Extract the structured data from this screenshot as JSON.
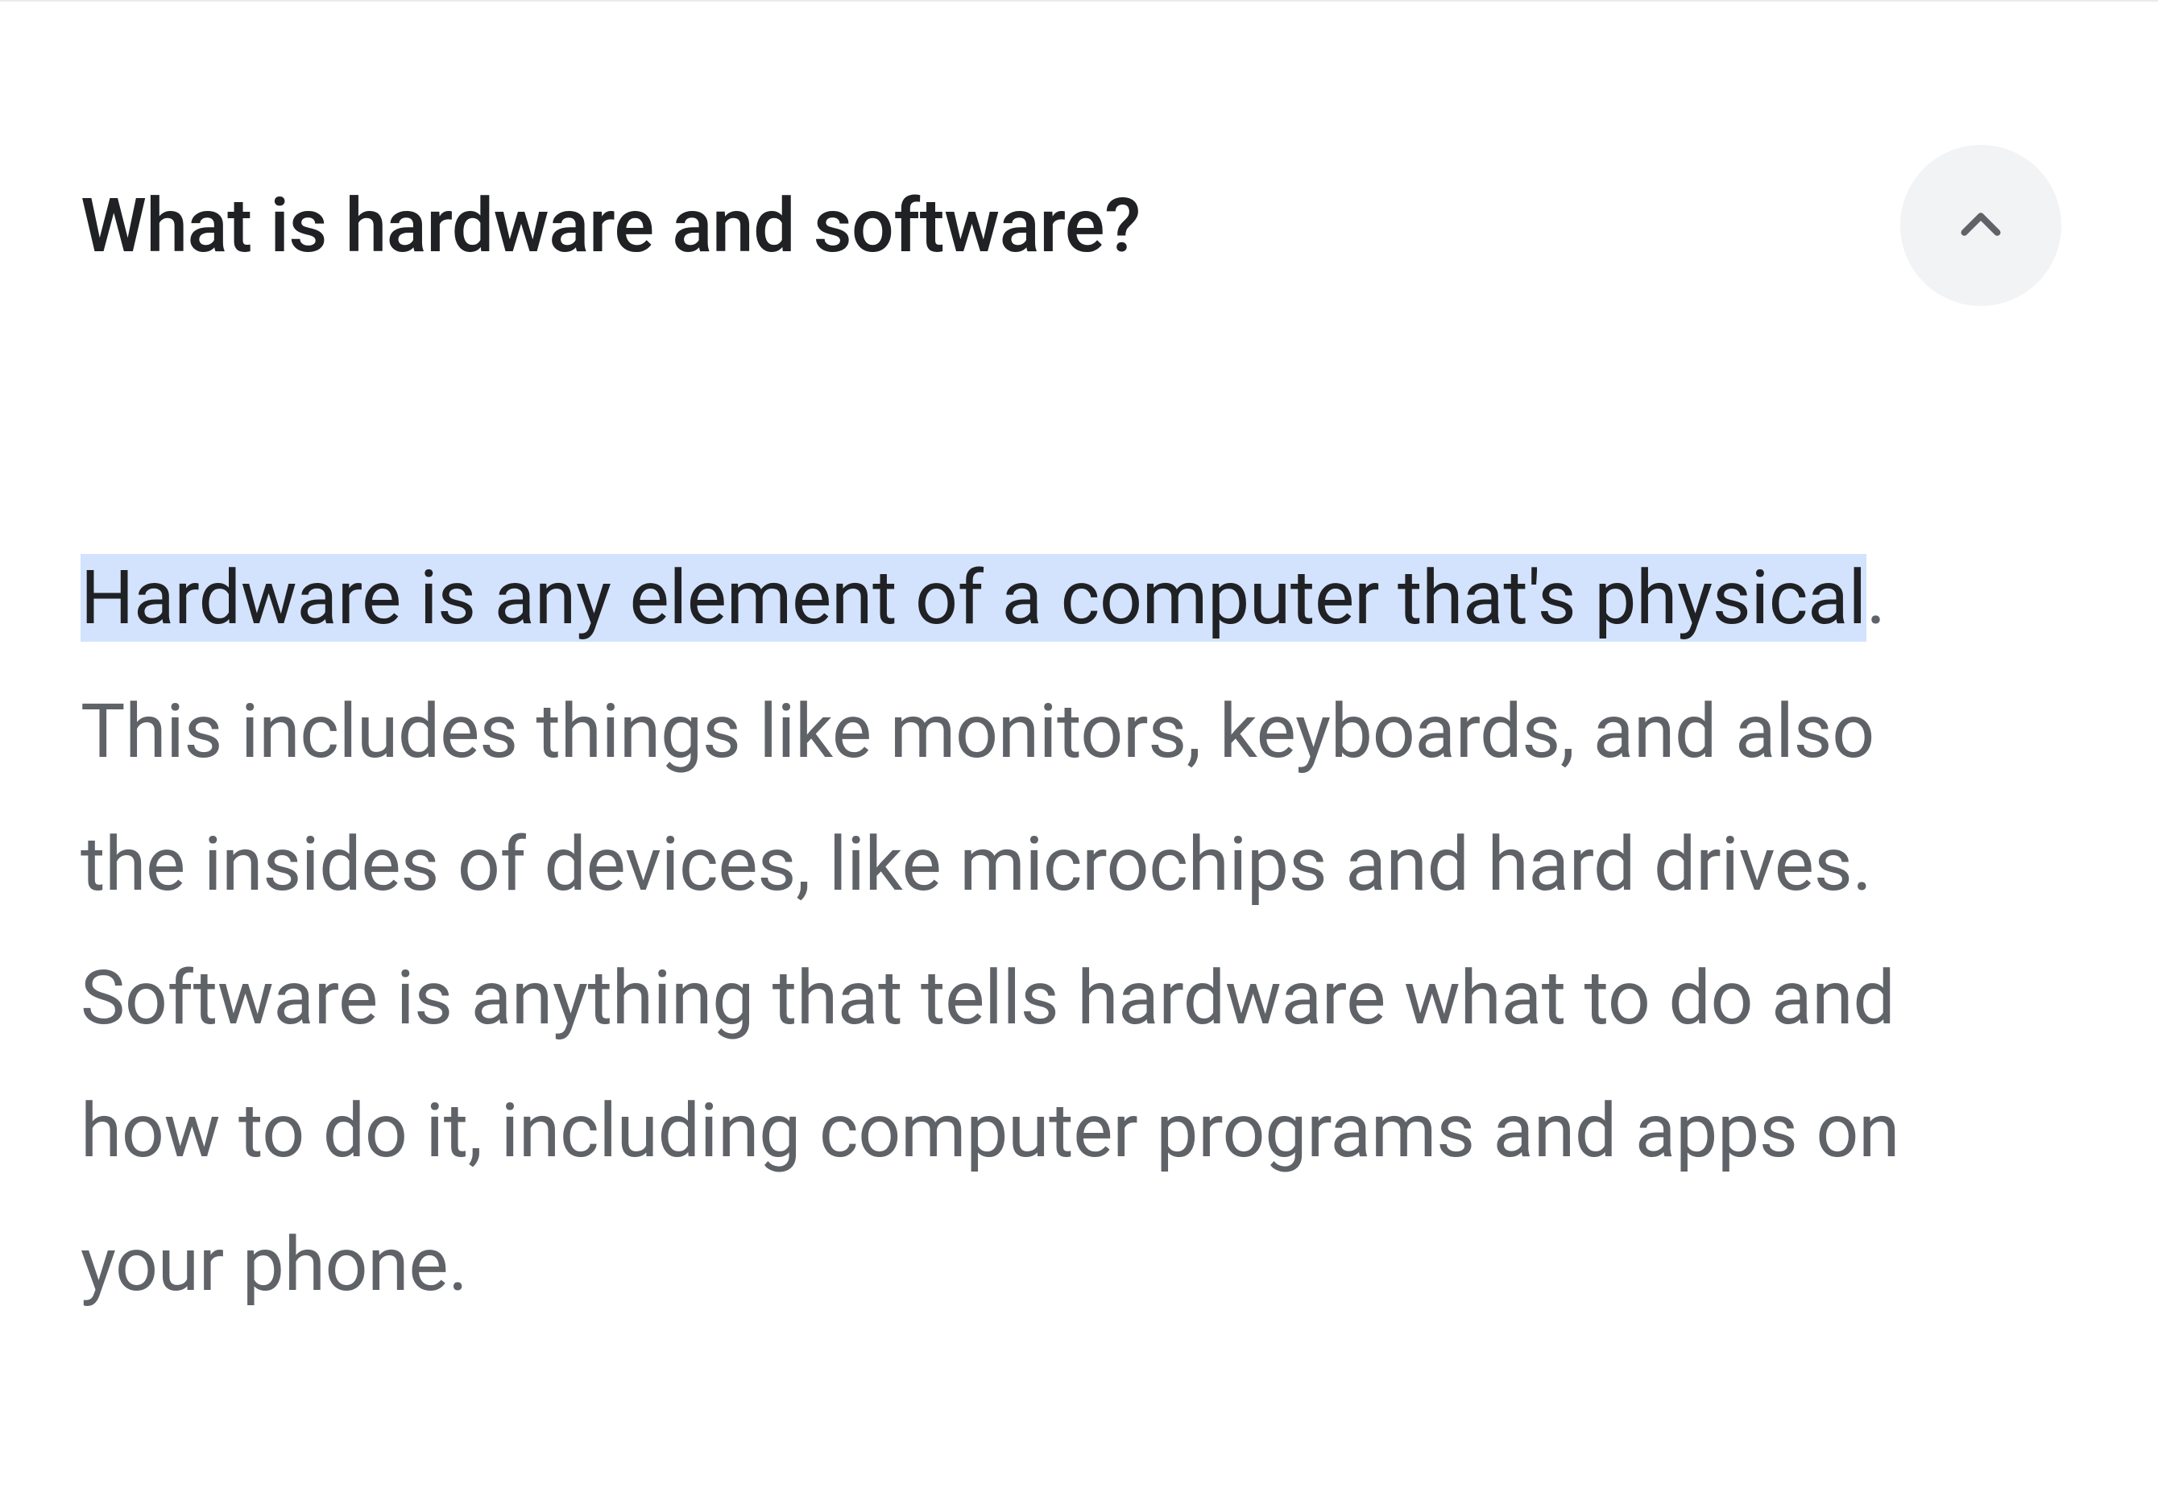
{
  "faq": {
    "question": "What is hardware and software?",
    "answer": {
      "highlighted": "Hardware is any element of a computer that's physical",
      "rest": ". This includes things like monitors, keyboards, and also the insides of devices, like microchips and hard drives. Software is anything that tells hardware what to do and how to do it, including computer programs and apps on your phone."
    }
  },
  "colors": {
    "highlight_bg": "#d3e3fd",
    "text_primary": "#202124",
    "text_secondary": "#5f6368",
    "button_bg": "#f1f3f4",
    "chevron": "#5f6368"
  }
}
